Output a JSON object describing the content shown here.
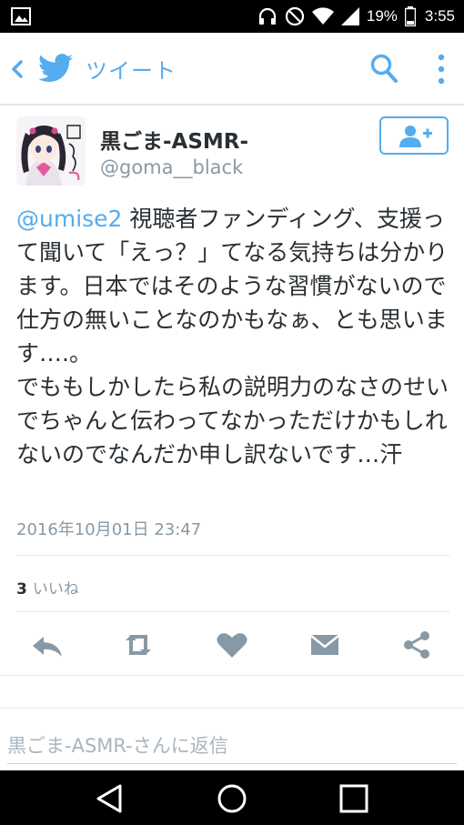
{
  "status_bar": {
    "battery_percent": "19%",
    "time": "3:55",
    "icons": [
      "image-icon",
      "headphones-icon",
      "do-not-disturb-icon",
      "wifi-icon",
      "signal-icon",
      "battery-icon"
    ]
  },
  "app_bar": {
    "title": "ツイート",
    "icons": [
      "back-icon",
      "twitter-bird-icon",
      "search-icon",
      "more-vert-icon"
    ],
    "accent_color": "#55acee"
  },
  "tweet": {
    "display_name": "黒ごま-ASMR-",
    "handle": "@goma__black",
    "mention": "@umise2",
    "body": " 視聴者ファンディング、支援って聞いて「えっ？」てなる気持ちは分かります。日本ではそのような習慣がないので仕方の無いことなのかもなぁ、とも思います….。\nでももしかしたら私の説明力のなさのせいでちゃんと伝わってなかっただけかもしれないのでなんだか申し訳ないです…汗",
    "timestamp": "2016年10月01日 23:47",
    "like_count": "3",
    "like_label": "いいね",
    "follow_icon": "add-user-icon",
    "action_icons": [
      "reply-icon",
      "retweet-icon",
      "like-heart-icon",
      "direct-message-icon",
      "share-icon"
    ]
  },
  "reply": {
    "placeholder": "黒ごま-ASMR-さんに返信"
  },
  "nav_bar": {
    "icons": [
      "nav-back-icon",
      "nav-home-icon",
      "nav-recents-icon"
    ]
  }
}
